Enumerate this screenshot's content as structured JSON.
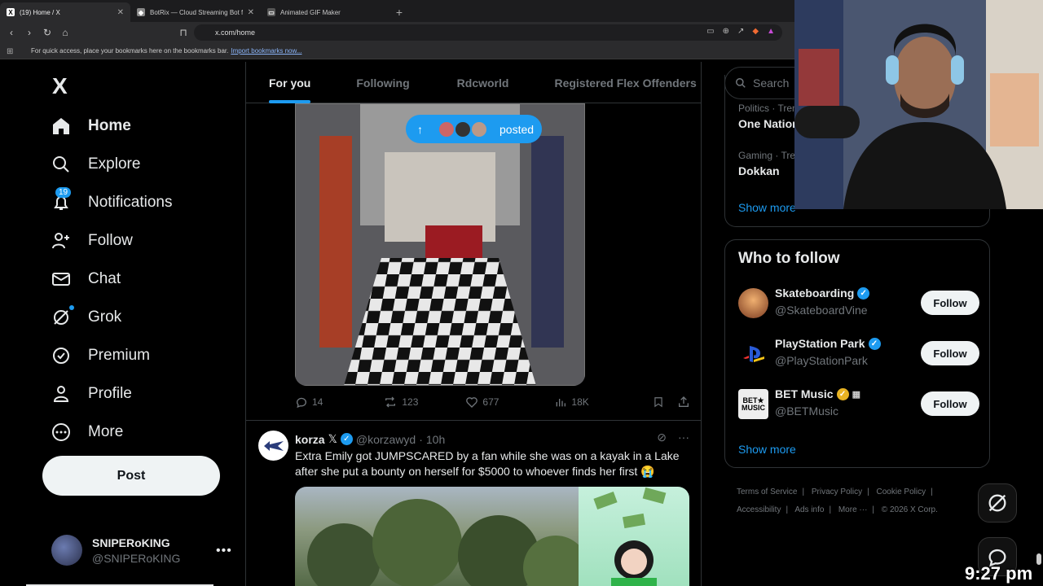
{
  "browser": {
    "tabs": [
      {
        "label": "(19) Home / X",
        "active": true
      },
      {
        "label": "BotRix — Cloud Streaming Bot for Tw",
        "active": false
      },
      {
        "label": "Animated GIF Maker",
        "active": false
      }
    ],
    "url": "x.com/home",
    "bookmarks_hint": "For quick access, place your bookmarks here on the bookmarks bar.",
    "import_link": "Import bookmarks now..."
  },
  "sidebar": {
    "logo": "X",
    "items": [
      {
        "label": "Home",
        "icon": "home-icon"
      },
      {
        "label": "Explore",
        "icon": "search-icon"
      },
      {
        "label": "Notifications",
        "icon": "bell-icon",
        "badge": "19"
      },
      {
        "label": "Follow",
        "icon": "person-add-icon"
      },
      {
        "label": "Chat",
        "icon": "mail-icon"
      },
      {
        "label": "Grok",
        "icon": "grok-icon"
      },
      {
        "label": "Premium",
        "icon": "premium-icon"
      },
      {
        "label": "Profile",
        "icon": "person-icon"
      },
      {
        "label": "More",
        "icon": "more-circle-icon"
      }
    ],
    "post_label": "Post",
    "account": {
      "name": "SNIPERoKING",
      "handle": "@SNIPERoKING"
    }
  },
  "feed": {
    "tabs": [
      "For you",
      "Following",
      "Rdcworld",
      "Registered Flex Offenders"
    ],
    "posted_pill": "posted",
    "tweet1_actions": {
      "replies": "14",
      "reposts": "123",
      "likes": "677",
      "views": "18K"
    },
    "tweet2": {
      "name": "korza",
      "handle": "@korzawyd",
      "time": "10h",
      "text": "Extra Emily got JUMPSCARED by a fan while she was on a kayak in a Lake after she put a bounty on herself for $5000 to whoever finds her first 😭"
    }
  },
  "right": {
    "search_placeholder": "Search",
    "trends": [
      {
        "meta": "Politics · Tren",
        "name": "One Nation"
      },
      {
        "meta": "Gaming · Tren",
        "name": "Dokkan"
      }
    ],
    "show_more": "Show more",
    "who_to_follow_title": "Who to follow",
    "suggestions": [
      {
        "name": "Skateboarding",
        "handle": "@SkateboardVine",
        "verified": "blue"
      },
      {
        "name": "PlayStation Park",
        "handle": "@PlayStationPark",
        "verified": "blue"
      },
      {
        "name": "BET Music",
        "handle": "@BETMusic",
        "verified": "gold"
      }
    ],
    "follow_label": "Follow",
    "show_more_2": "Show more",
    "footer": [
      "Terms of Service",
      "Privacy Policy",
      "Cookie Policy",
      "Accessibility",
      "Ads info",
      "More ···",
      "© 2026 X Corp."
    ]
  },
  "overlay": {
    "time": "9:27 pm"
  },
  "colors": {
    "accent": "#1d9bf0",
    "background": "#000000",
    "border": "#2f3336"
  }
}
